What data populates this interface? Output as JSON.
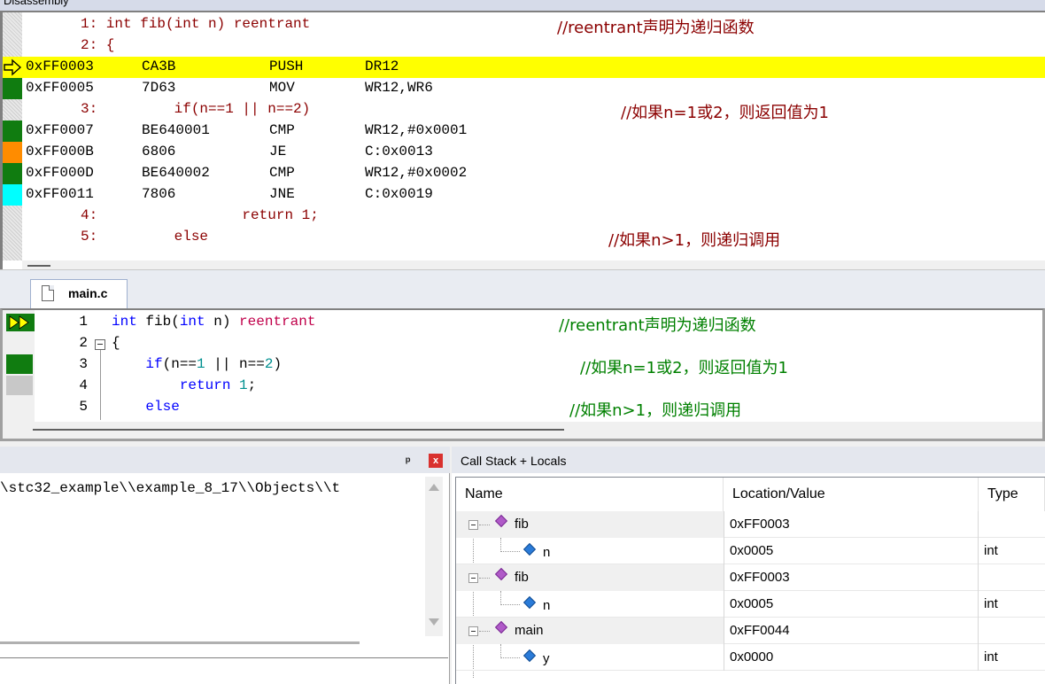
{
  "disassembly": {
    "title": "Disassembly",
    "lines": [
      {
        "kind": "src",
        "text": "1: int fib(int n) reentrant",
        "comment": "//reentrant声明为递归函数"
      },
      {
        "kind": "src",
        "text": "2: {",
        "comment": ""
      },
      {
        "kind": "asm",
        "addr": "0xFF0003",
        "opcode": "CA3B",
        "mnemonic": "PUSH",
        "operand": "DR12",
        "marker": "current"
      },
      {
        "kind": "asm",
        "addr": "0xFF0005",
        "opcode": "7D63",
        "mnemonic": "MOV",
        "operand": "WR12,WR6",
        "marker": "green"
      },
      {
        "kind": "src",
        "text": "3:         if(n==1 || n==2)",
        "comment": "//如果n=1或2，则返回值为1"
      },
      {
        "kind": "asm",
        "addr": "0xFF0007",
        "opcode": "BE640001",
        "mnemonic": "CMP",
        "operand": "WR12,#0x0001",
        "marker": "green"
      },
      {
        "kind": "asm",
        "addr": "0xFF000B",
        "opcode": "6806",
        "mnemonic": "JE",
        "operand": "C:0x0013",
        "marker": "orange"
      },
      {
        "kind": "asm",
        "addr": "0xFF000D",
        "opcode": "BE640002",
        "mnemonic": "CMP",
        "operand": "WR12,#0x0002",
        "marker": "green"
      },
      {
        "kind": "asm",
        "addr": "0xFF0011",
        "opcode": "7806",
        "mnemonic": "JNE",
        "operand": "C:0x0019",
        "marker": "cyan"
      },
      {
        "kind": "src",
        "text": "4:                 return 1;",
        "comment": ""
      },
      {
        "kind": "src",
        "text": "5:         else",
        "comment": "//如果n>1，则递归调用"
      }
    ]
  },
  "editor": {
    "tab_label": "main.c",
    "lines": [
      {
        "num": "1",
        "code": "int fib(int n) reentrant",
        "comment": "//reentrant声明为递归函数"
      },
      {
        "num": "2",
        "code": "{",
        "comment": ""
      },
      {
        "num": "3",
        "code": "    if(n==1 || n==2)",
        "comment": "//如果n=1或2，则返回值为1"
      },
      {
        "num": "4",
        "code": "        return 1;",
        "comment": ""
      },
      {
        "num": "5",
        "code": "    else",
        "comment": "//如果n>1，则递归调用"
      }
    ]
  },
  "command_panel": {
    "pin_glyph": "ᵖ",
    "close_glyph": "x",
    "path_text": "\\stc32_example\\\\example_8_17\\\\Objects\\\\t"
  },
  "call_stack": {
    "title": "Call Stack + Locals",
    "columns": [
      "Name",
      "Location/Value",
      "Type"
    ],
    "rows": [
      {
        "level": 0,
        "name": "fib",
        "value": "0xFF0003",
        "type": ""
      },
      {
        "level": 1,
        "name": "n",
        "value": "0x0005",
        "type": "int"
      },
      {
        "level": 0,
        "name": "fib",
        "value": "0xFF0003",
        "type": ""
      },
      {
        "level": 1,
        "name": "n",
        "value": "0x0005",
        "type": "int"
      },
      {
        "level": 0,
        "name": "main",
        "value": "0xFF0044",
        "type": ""
      },
      {
        "level": 1,
        "name": "y",
        "value": "0x0000",
        "type": "int"
      }
    ]
  },
  "colors": {
    "current_line": "#ffff00",
    "marker_green": "#107c10",
    "marker_orange": "#ff8c00",
    "marker_cyan": "#00ffff",
    "comment_dark_red": "#8b0000",
    "comment_green": "#008000",
    "keyword_blue": "#0000ff"
  }
}
